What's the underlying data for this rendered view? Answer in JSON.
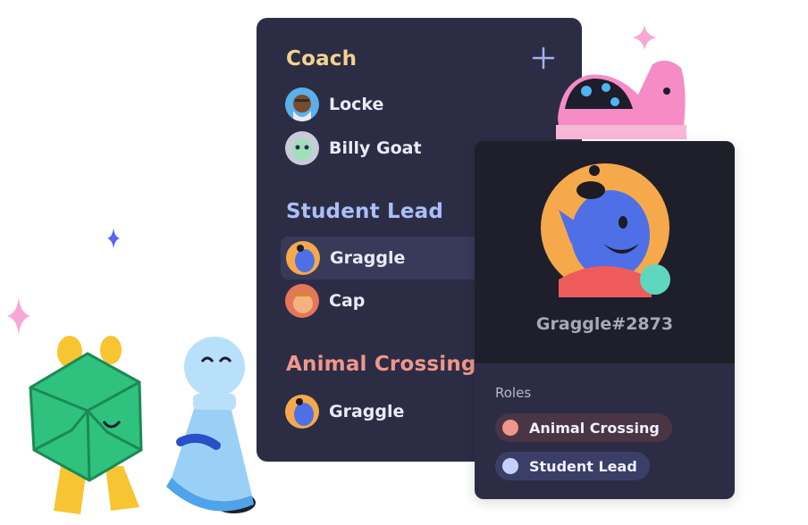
{
  "colors": {
    "coach": "#f2d38f",
    "student_lead": "#a9bff8",
    "animal_crossing": "#f0968a",
    "animal_crossing_pill": "#4a3545",
    "student_lead_pill": "#3b3e66",
    "online_status": "#5fd6be"
  },
  "member_list": {
    "add_icon": "plus-icon",
    "groups": [
      {
        "role": "Coach",
        "members": [
          {
            "name": "Locke"
          },
          {
            "name": "Billy Goat"
          }
        ]
      },
      {
        "role": "Student Lead",
        "members": [
          {
            "name": "Graggle"
          },
          {
            "name": "Cap"
          }
        ]
      },
      {
        "role": "Animal Crossing",
        "members": [
          {
            "name": "Graggle"
          }
        ]
      }
    ]
  },
  "profile": {
    "username": "Graggle#2873",
    "roles_title": "Roles",
    "roles": [
      {
        "name": "Animal Crossing"
      },
      {
        "name": "Student Lead"
      }
    ]
  }
}
